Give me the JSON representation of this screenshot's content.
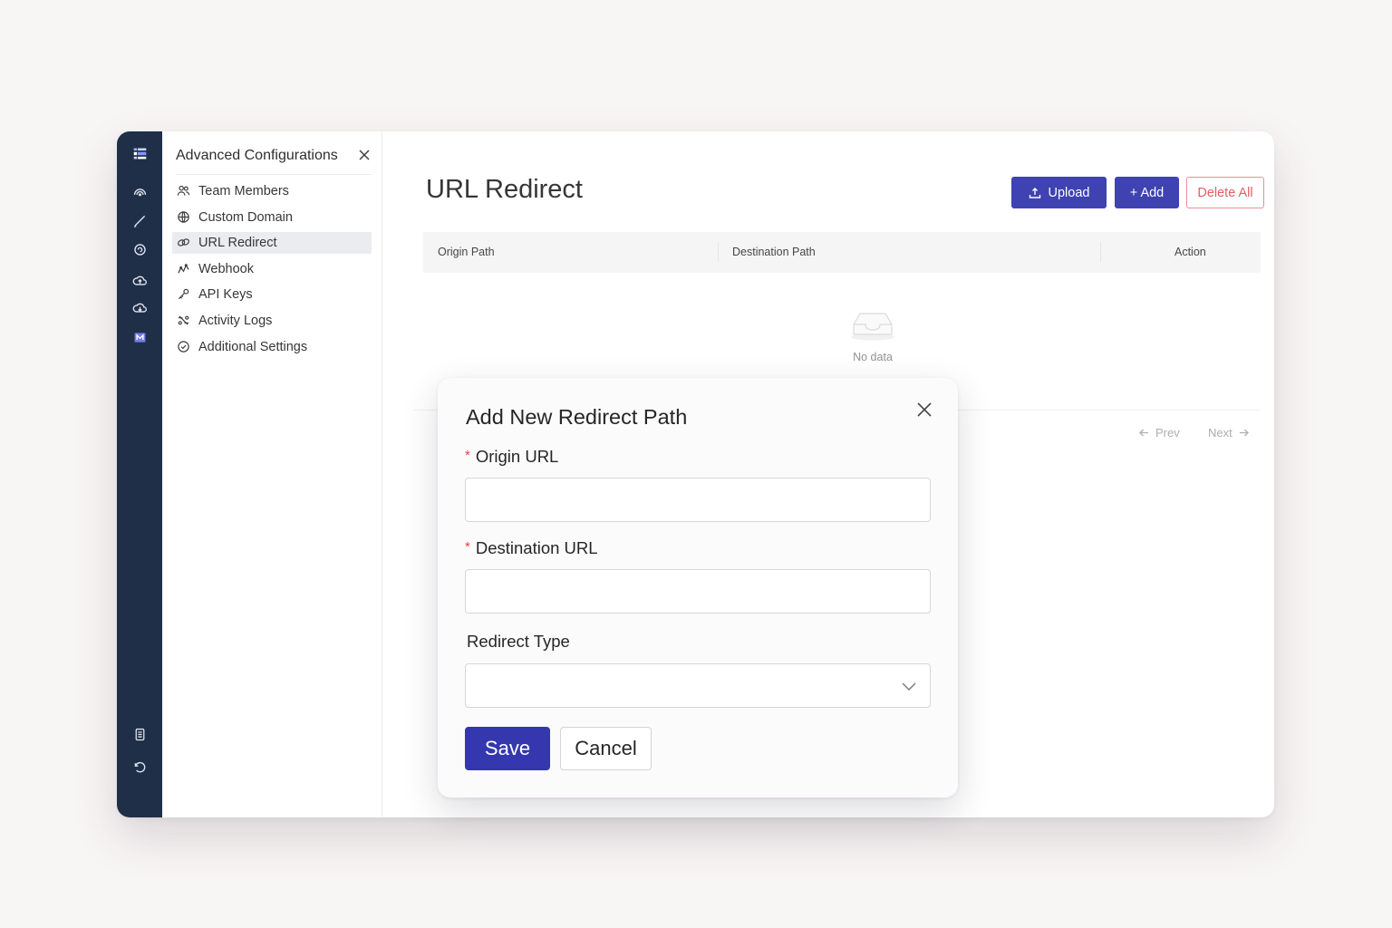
{
  "sidebar": {
    "title": "Advanced Configurations",
    "items": [
      {
        "label": "Team Members",
        "icon": "users-icon"
      },
      {
        "label": "Custom Domain",
        "icon": "globe-icon"
      },
      {
        "label": "URL Redirect",
        "icon": "link-icon",
        "active": true
      },
      {
        "label": "Webhook",
        "icon": "webhook-icon"
      },
      {
        "label": "API Keys",
        "icon": "key-icon"
      },
      {
        "label": "Activity Logs",
        "icon": "activity-icon"
      },
      {
        "label": "Additional Settings",
        "icon": "settings-check-icon"
      }
    ]
  },
  "rail": {
    "icons": [
      "logo-icon",
      "broadcast-icon",
      "pen-icon",
      "refresh-icon",
      "cloud-upload-icon",
      "cloud-download-icon",
      "brand-icon",
      "document-icon",
      "history-icon"
    ]
  },
  "main": {
    "title": "URL Redirect",
    "upload_label": "Upload",
    "add_label": "+ Add",
    "delete_all_label": "Delete All",
    "columns": [
      "Origin Path",
      "Destination Path",
      "Action"
    ],
    "empty_text": "No data",
    "prev_label": "Prev",
    "next_label": "Next"
  },
  "modal": {
    "title": "Add New Redirect Path",
    "origin_label": "Origin URL",
    "origin_value": "",
    "destination_label": "Destination URL",
    "destination_value": "",
    "redirect_type_label": "Redirect Type",
    "redirect_type_value": "",
    "required_marker": "*",
    "save_label": "Save",
    "cancel_label": "Cancel"
  },
  "colors": {
    "primary": "#3437ad",
    "rail": "#13233d",
    "danger": "#e0555d",
    "background": "#f8f5f5"
  }
}
